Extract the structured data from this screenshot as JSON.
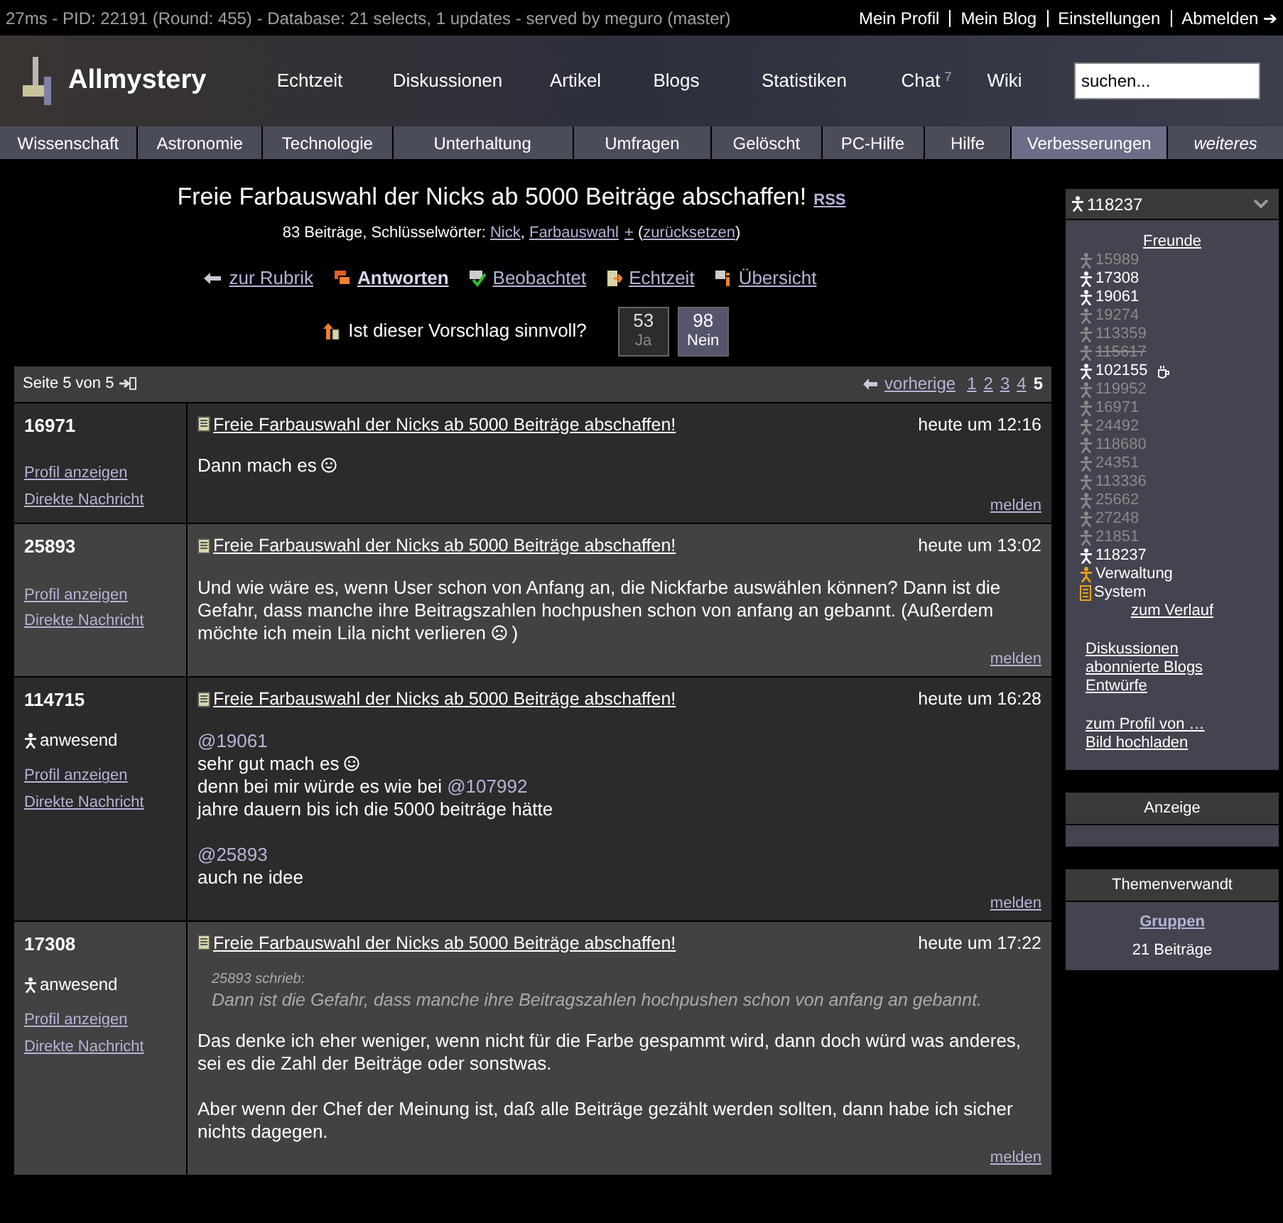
{
  "top_bar": {
    "status": "27ms - PID: 22191 (Round: 455) - Database: 21 selects, 1 updates - served by meguro (master)",
    "links": [
      "Mein Profil",
      "Mein Blog",
      "Einstellungen",
      "Abmelden ➔"
    ]
  },
  "header": {
    "logo": "Allmystery",
    "nav": [
      {
        "label": "Echtzeit"
      },
      {
        "label": "Diskussionen"
      },
      {
        "label": "Artikel"
      },
      {
        "label": "Blogs"
      },
      {
        "label": "Statistiken"
      },
      {
        "label": "Chat",
        "badge": "7"
      },
      {
        "label": "Wiki"
      }
    ],
    "search": {
      "placeholder": "suchen..."
    }
  },
  "categories": [
    {
      "label": "Wissenschaft",
      "selected": false,
      "kind": "tab"
    },
    {
      "label": "Astronomie",
      "selected": false,
      "kind": "tab"
    },
    {
      "label": "Technologie",
      "selected": false,
      "kind": "tab"
    },
    {
      "label": "Unterhaltung",
      "selected": false,
      "kind": "tab"
    },
    {
      "label": "Umfragen",
      "selected": false,
      "kind": "tab"
    },
    {
      "label": "Gelöscht",
      "selected": false,
      "kind": "tab"
    },
    {
      "label": "PC-Hilfe",
      "selected": false,
      "kind": "tab"
    },
    {
      "label": "Hilfe",
      "selected": false,
      "kind": "tab"
    },
    {
      "label": "Verbesserungen",
      "selected": true,
      "kind": "tab"
    },
    {
      "label": "weiteres",
      "selected": false,
      "kind": "more"
    }
  ],
  "thread": {
    "title": "Freie Farbauswahl der Nicks ab 5000 Beiträge abschaffen!",
    "rss": "RSS",
    "meta": [
      {
        "kind": "text",
        "text": "83 Beiträge, Schlüsselwörter: "
      },
      {
        "kind": "link",
        "text": "Nick"
      },
      {
        "kind": "text",
        "text": ", "
      },
      {
        "kind": "link",
        "text": "Farbauswahl"
      },
      {
        "kind": "link",
        "text": "+"
      },
      {
        "kind": "text",
        "text": " ("
      },
      {
        "kind": "link",
        "text": "zurücksetzen"
      },
      {
        "kind": "text",
        "text": ")"
      }
    ],
    "actions": [
      {
        "kind": "back",
        "label": "zur Rubrik"
      },
      {
        "kind": "reply",
        "label": "Antworten"
      },
      {
        "kind": "watch",
        "label": "Beobachtet"
      },
      {
        "kind": "live",
        "label": "Echtzeit"
      },
      {
        "kind": "overview",
        "label": "Übersicht"
      }
    ],
    "poll": {
      "question": "Ist dieser Vorschlag sinnvoll?",
      "options": [
        {
          "count": "53",
          "label": "Ja",
          "selected": false
        },
        {
          "count": "98",
          "label": "Nein",
          "selected": true
        }
      ]
    }
  },
  "pagination": {
    "label": "Seite 5 von 5",
    "previous": "vorherige",
    "pages": [
      {
        "label": "1",
        "selected": false
      },
      {
        "label": "2",
        "selected": false
      },
      {
        "label": "3",
        "selected": false
      },
      {
        "label": "4",
        "selected": false
      },
      {
        "label": "5",
        "selected": true
      }
    ]
  },
  "posts": [
    {
      "author": "16971",
      "present": false,
      "links": [
        "Profil anzeigen",
        "Direkte Nachricht"
      ],
      "title": "Freie Farbauswahl der Nicks ab 5000 Beiträge abschaffen!",
      "time": "heute um 12:16",
      "report": "melden",
      "body": [
        {
          "kind": "line",
          "parts": [
            {
              "kind": "text",
              "text": "Dann mach es "
            },
            {
              "kind": "grin"
            }
          ]
        }
      ]
    },
    {
      "author": "25893",
      "present": false,
      "links": [
        "Profil anzeigen",
        "Direkte Nachricht"
      ],
      "title": "Freie Farbauswahl der Nicks ab 5000 Beiträge abschaffen!",
      "time": "heute um 13:02",
      "report": "melden",
      "body": [
        {
          "kind": "line",
          "parts": [
            {
              "kind": "text",
              "text": "Und wie wäre es, wenn User schon von Anfang an, die Nickfarbe auswählen können? Dann ist die Gefahr, dass manche ihre Beitragszahlen hochpushen schon von anfang an gebannt. (Außerdem möchte ich mein Lila nicht verlieren "
            },
            {
              "kind": "sad"
            },
            {
              "kind": "text",
              "text": " )"
            }
          ]
        }
      ]
    },
    {
      "author": "114715",
      "present": true,
      "status": "anwesend",
      "links": [
        "Profil anzeigen",
        "Direkte Nachricht"
      ],
      "title": "Freie Farbauswahl der Nicks ab 5000 Beiträge abschaffen!",
      "time": "heute um 16:28",
      "report": "melden",
      "body": [
        {
          "kind": "line",
          "parts": [
            {
              "kind": "mention",
              "text": "@19061"
            }
          ]
        },
        {
          "kind": "line",
          "parts": [
            {
              "kind": "text",
              "text": "sehr gut mach es "
            },
            {
              "kind": "smile"
            }
          ]
        },
        {
          "kind": "line",
          "parts": [
            {
              "kind": "text",
              "text": "denn bei mir würde es wie bei "
            },
            {
              "kind": "mention",
              "text": "@107992"
            }
          ]
        },
        {
          "kind": "line",
          "parts": [
            {
              "kind": "text",
              "text": "jahre dauern bis ich die 5000 beiträge hätte"
            }
          ]
        },
        {
          "kind": "gap"
        },
        {
          "kind": "line",
          "parts": [
            {
              "kind": "mention",
              "text": "@25893"
            }
          ]
        },
        {
          "kind": "line",
          "parts": [
            {
              "kind": "text",
              "text": "auch ne idee"
            }
          ]
        }
      ]
    },
    {
      "author": "17308",
      "present": true,
      "status": "anwesend",
      "links": [
        "Profil anzeigen",
        "Direkte Nachricht"
      ],
      "title": "Freie Farbauswahl der Nicks ab 5000 Beiträge abschaffen!",
      "time": "heute um 17:22",
      "report": "melden",
      "body": [
        {
          "kind": "quote",
          "author": "25893 schrieb:",
          "text": "Dann ist die Gefahr, dass manche ihre Beitragszahlen hochpushen schon von anfang an gebannt."
        },
        {
          "kind": "line",
          "parts": [
            {
              "kind": "text",
              "text": "Das denke ich eher weniger, wenn nicht für die Farbe gespammt wird, dann doch würd was anderes, sei es die Zahl der Beiträge oder sonstwas."
            }
          ]
        },
        {
          "kind": "gap"
        },
        {
          "kind": "line",
          "parts": [
            {
              "kind": "text",
              "text": "Aber wenn der Chef der Meinung ist, daß alle Beiträge gezählt werden sollten, dann habe ich sicher nichts dagegen."
            }
          ]
        }
      ]
    }
  ],
  "sidebar": {
    "user": "118237",
    "friends_heading": "Freunde",
    "friends": [
      {
        "name": "15989",
        "kind": "user",
        "online": false,
        "struck": false,
        "idle": false
      },
      {
        "name": "17308",
        "kind": "user",
        "online": true,
        "struck": false,
        "idle": false
      },
      {
        "name": "19061",
        "kind": "user",
        "online": true,
        "struck": false,
        "idle": false
      },
      {
        "name": "19274",
        "kind": "user",
        "online": false,
        "struck": false,
        "idle": false
      },
      {
        "name": "113359",
        "kind": "user",
        "online": false,
        "struck": false,
        "idle": false
      },
      {
        "name": "115617",
        "kind": "user",
        "online": false,
        "struck": true,
        "idle": false
      },
      {
        "name": "102155",
        "kind": "user",
        "online": true,
        "struck": false,
        "idle": true
      },
      {
        "name": "119952",
        "kind": "user",
        "online": false,
        "struck": false,
        "idle": false
      },
      {
        "name": "16971",
        "kind": "user",
        "online": false,
        "struck": false,
        "idle": false
      },
      {
        "name": "24492",
        "kind": "user",
        "online": false,
        "struck": false,
        "idle": false
      },
      {
        "name": "118680",
        "kind": "user",
        "online": false,
        "struck": false,
        "idle": false
      },
      {
        "name": "24351",
        "kind": "user",
        "online": false,
        "struck": false,
        "idle": false
      },
      {
        "name": "113336",
        "kind": "user",
        "online": false,
        "struck": false,
        "idle": false
      },
      {
        "name": "25662",
        "kind": "user",
        "online": false,
        "struck": false,
        "idle": false
      },
      {
        "name": "27248",
        "kind": "user",
        "online": false,
        "struck": false,
        "idle": false
      },
      {
        "name": "21851",
        "kind": "user",
        "online": false,
        "struck": false,
        "idle": false
      },
      {
        "name": "118237",
        "kind": "user",
        "online": true,
        "struck": false,
        "idle": false
      },
      {
        "name": "Verwaltung",
        "kind": "admin",
        "online": true,
        "struck": false,
        "idle": false
      },
      {
        "name": "System",
        "kind": "system",
        "online": true,
        "struck": false,
        "idle": false
      }
    ],
    "history_link": "zum Verlauf",
    "link_groups": [
      [
        "Diskussionen",
        "abonnierte Blogs",
        "Entwürfe"
      ],
      [
        "zum Profil von …",
        "Bild hochladen"
      ]
    ],
    "ad_heading": "Anzeige",
    "related": {
      "heading": "Themenverwandt",
      "link": "Gruppen",
      "count": "21 Beiträge"
    }
  }
}
